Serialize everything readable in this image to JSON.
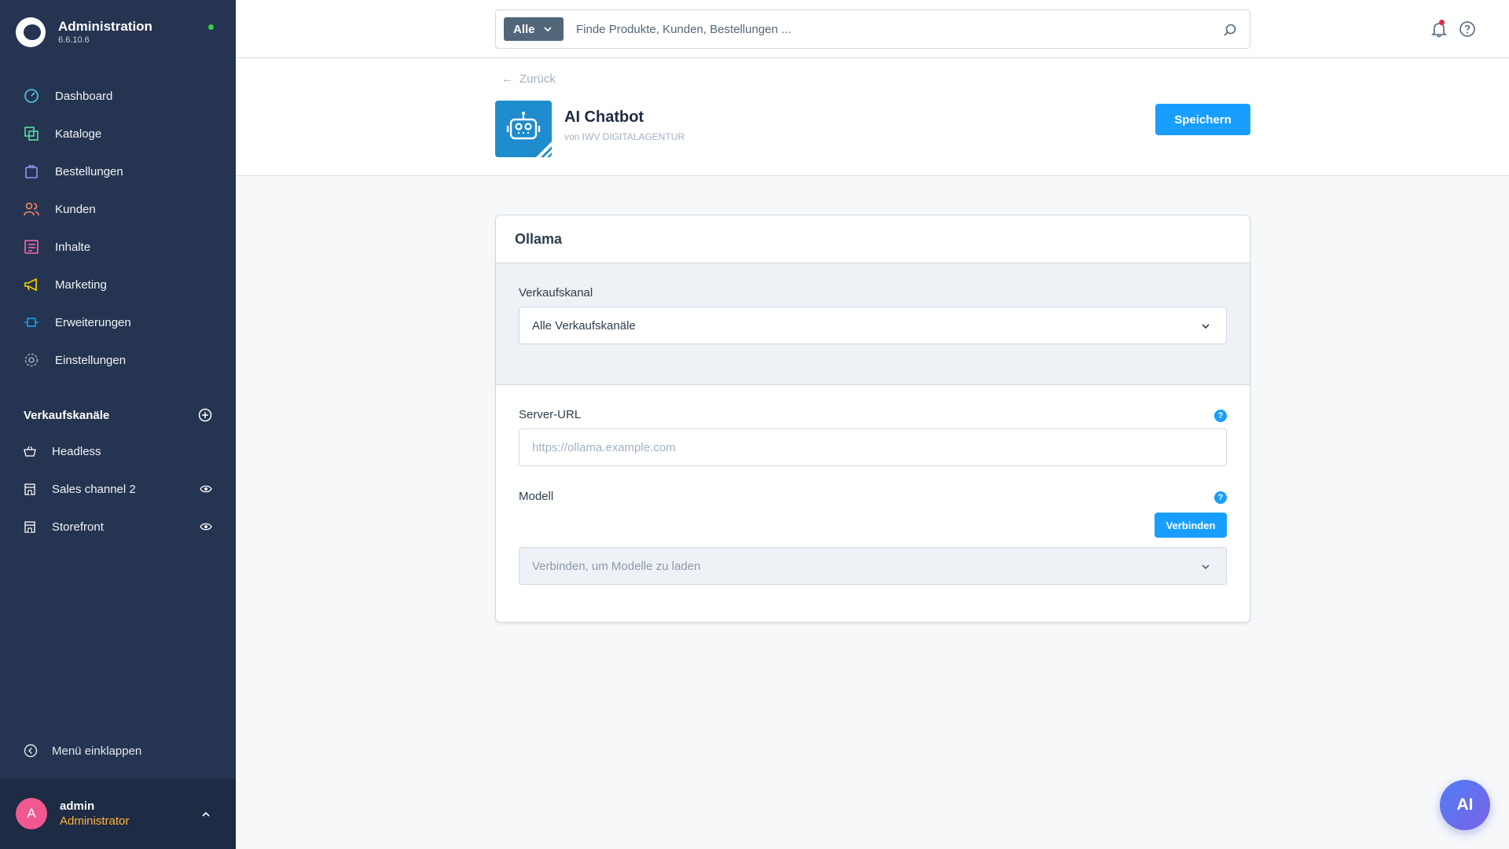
{
  "app": {
    "title": "Administration",
    "version": "6.6.10.6"
  },
  "nav": {
    "items": [
      {
        "label": "Dashboard",
        "icon": "dashboard-icon",
        "color": "#56c9ef"
      },
      {
        "label": "Kataloge",
        "icon": "catalog-icon",
        "color": "#57d9a3"
      },
      {
        "label": "Bestellungen",
        "icon": "shopping-bag-icon",
        "color": "#a092f0"
      },
      {
        "label": "Kunden",
        "icon": "customers-icon",
        "color": "#f88962"
      },
      {
        "label": "Inhalte",
        "icon": "content-icon",
        "color": "#ff68b4"
      },
      {
        "label": "Marketing",
        "icon": "megaphone-icon",
        "color": "#ffd700"
      },
      {
        "label": "Erweiterungen",
        "icon": "plugin-icon",
        "color": "#189eff"
      },
      {
        "label": "Einstellungen",
        "icon": "gear-icon",
        "color": "#9aa8b5"
      }
    ]
  },
  "sales_channels": {
    "title": "Verkaufskanäle",
    "items": [
      {
        "label": "Headless",
        "icon": "basket-icon",
        "has_eye": false
      },
      {
        "label": "Sales channel 2",
        "icon": "storefront-icon",
        "has_eye": true
      },
      {
        "label": "Storefront",
        "icon": "storefront-icon",
        "has_eye": true
      }
    ]
  },
  "collapse_label": "Menü einklappen",
  "user": {
    "initial": "A",
    "name": "admin",
    "role": "Administrator"
  },
  "search": {
    "type_label": "Alle",
    "placeholder": "Finde Produkte, Kunden, Bestellungen ..."
  },
  "page": {
    "back_label": "Zurück",
    "app_name": "AI Chatbot",
    "vendor": "von IWV DIGITALAGENTUR",
    "save_label": "Speichern"
  },
  "card": {
    "title": "Ollama",
    "channel_label": "Verkaufskanal",
    "channel_value": "Alle Verkaufskanäle",
    "server_url_label": "Server-URL",
    "server_url_placeholder": "https://ollama.example.com",
    "server_url_value": "",
    "model_label": "Modell",
    "connect_label": "Verbinden",
    "model_placeholder": "Verbinden, um Modelle zu laden"
  },
  "ai_button_label": "AI",
  "colors": {
    "sidebar": "#253450",
    "primary": "#189eff",
    "role": "#ffb43d",
    "avatar": "#f0588f"
  }
}
